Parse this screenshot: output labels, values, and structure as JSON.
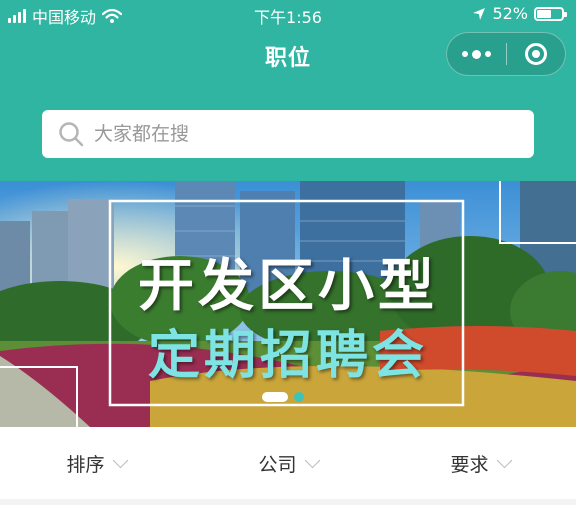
{
  "status_bar": {
    "carrier": "中国移动",
    "time": "下午1:56",
    "battery_percent": "52%",
    "battery_level": 0.52,
    "icons": [
      "signal-icon",
      "wifi-icon",
      "location-arrow-icon",
      "battery-icon"
    ]
  },
  "nav": {
    "title": "职位",
    "capsule_icons": [
      "more-dots-icon",
      "close-target-icon"
    ]
  },
  "search": {
    "placeholder": "大家都在搜",
    "value": ""
  },
  "banner": {
    "line1": "开发区小型",
    "line2": "定期招聘会",
    "pages": 2,
    "active_page": 1
  },
  "filters": [
    {
      "label": "排序"
    },
    {
      "label": "公司"
    },
    {
      "label": "要求"
    }
  ],
  "colors": {
    "header_bg": "#2fb5a1",
    "banner_line2": "#7de3e3"
  }
}
